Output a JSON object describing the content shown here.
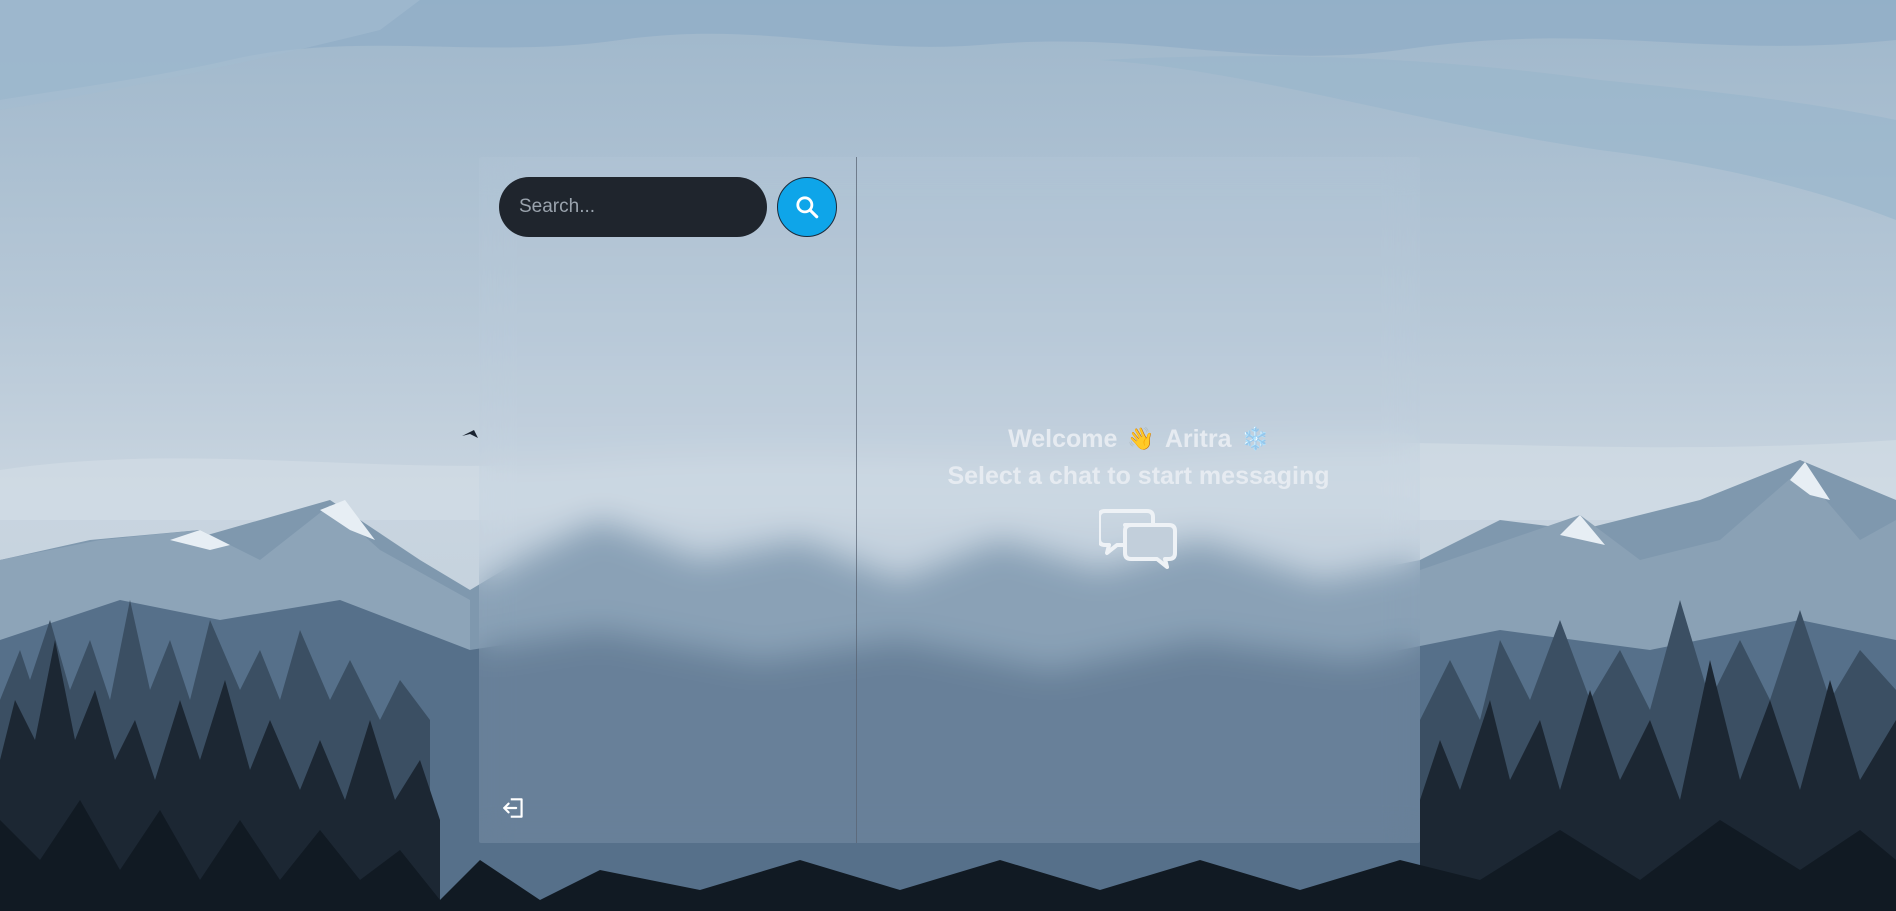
{
  "search": {
    "placeholder": "Search..."
  },
  "welcome": {
    "greeting": "Welcome",
    "wave_emoji": "👋",
    "user_name": "Aritra",
    "snowflake_emoji": "❄️",
    "subtitle": "Select a chat to start messaging"
  },
  "icons": {
    "search": "search-icon",
    "logout": "logout-icon",
    "chat": "chat-bubbles-icon"
  },
  "colors": {
    "accent": "#0ea5e9",
    "input_bg": "#1f252d",
    "text": "#e6ebf1"
  }
}
